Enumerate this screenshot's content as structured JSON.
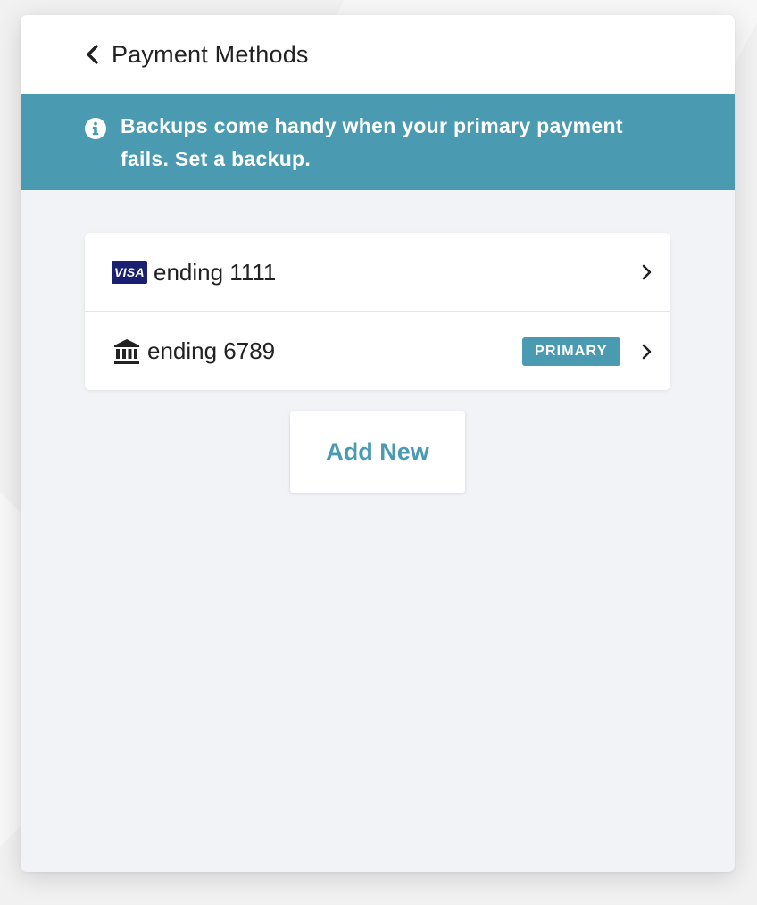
{
  "header": {
    "back_icon": "chevron-left-icon",
    "title": "Payment Methods"
  },
  "banner": {
    "icon": "info-icon",
    "text": "Backups come handy when your primary payment fails. Set a backup.",
    "background_color": "#4a9bb1"
  },
  "payment_methods": [
    {
      "icon": "visa-card-icon",
      "brand_text": "VISA",
      "label": "ending 1111",
      "badge": null
    },
    {
      "icon": "bank-icon",
      "label": "ending 6789",
      "badge": "PRIMARY"
    }
  ],
  "add_button": {
    "label": "Add New"
  },
  "colors": {
    "accent": "#4a9bb1",
    "visa_blue": "#1a1f71",
    "panel_background": "#f2f3f7"
  }
}
